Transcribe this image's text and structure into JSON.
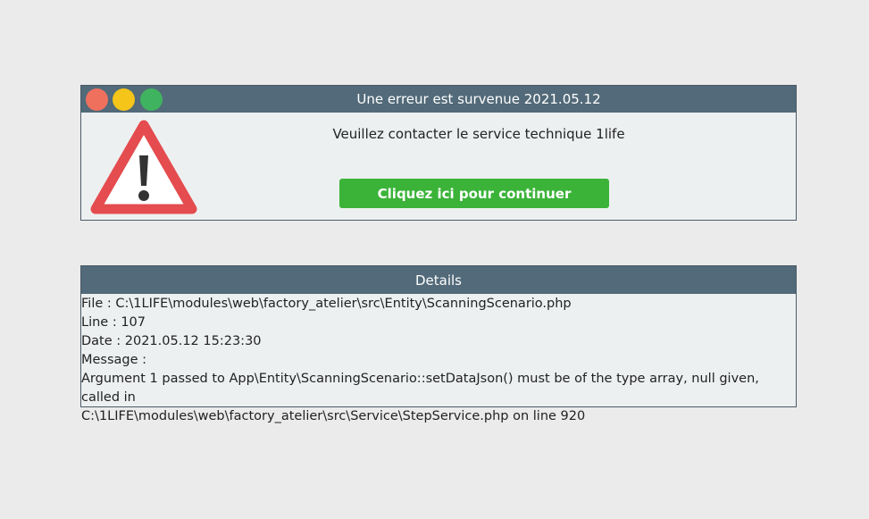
{
  "error_dialog": {
    "title": "Une erreur est survenue 2021.05.12",
    "message": "Veuillez contacter le service technique 1life",
    "continue_label": "Cliquez ici pour continuer",
    "warning_icon": "warning-triangle-icon"
  },
  "colors": {
    "titlebar": "#526a79",
    "button": "#3bb339",
    "dot_red": "#f0705e",
    "dot_yellow": "#f5c519",
    "dot_green": "#3fb35f",
    "warning_red": "#e44c4f"
  },
  "details": {
    "header": "Details",
    "file": "File : C:\\1LIFE\\modules\\web\\factory_atelier\\src\\Entity\\ScanningScenario.php",
    "line": "Line : 107",
    "date": "Date : 2021.05.12 15:23:30",
    "message_label": "Message :",
    "message_line1": "Argument 1 passed to App\\Entity\\ScanningScenario::setDataJson() must be of the type array, null given, called in",
    "message_line2": "C:\\1LIFE\\modules\\web\\factory_atelier\\src\\Service\\StepService.php on line 920"
  }
}
